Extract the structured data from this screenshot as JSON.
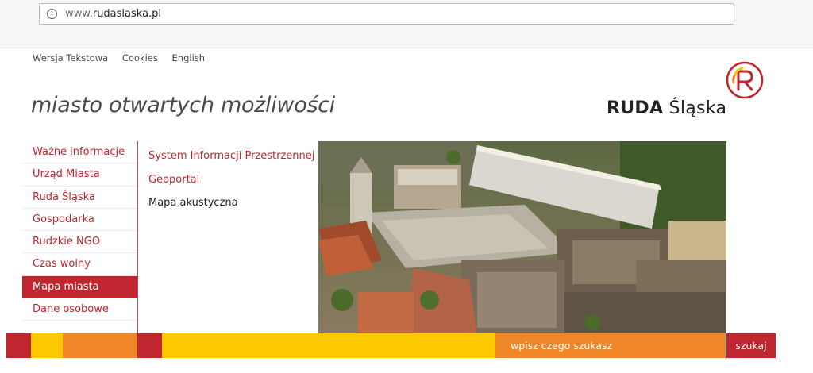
{
  "browser": {
    "url_prefix": "www.",
    "url_domain": "rudaslaska.pl",
    "info_icon": "info-icon"
  },
  "toplinks": [
    "Wersja Tekstowa",
    "Cookies",
    "English"
  ],
  "tagline": "miasto otwartych możliwości",
  "logo": {
    "bold": "RUDA",
    "light": "Śląska",
    "mark_letter": "R",
    "colors": {
      "red": "#c0262f",
      "orange": "#ef8627",
      "yellow": "#fcc800"
    }
  },
  "menu": {
    "items": [
      "Ważne informacje",
      "Urząd Miasta",
      "Ruda Śląska",
      "Gospodarka",
      "Rudzkie NGO",
      "Czas wolny",
      "Mapa miasta",
      "Dane osobowe"
    ],
    "active": "Mapa miasta"
  },
  "submenu": [
    "System Informacji Przestrzennej",
    "Geoportal",
    "Mapa akustyczna"
  ],
  "search": {
    "placeholder": "wpisz czego szukasz",
    "button": "szukaj"
  },
  "bar_colors": [
    "#c0262f",
    "#fcc800",
    "#ef8627",
    "#c0262f",
    "#fcc800",
    "#ef8627",
    "#c0262f"
  ]
}
